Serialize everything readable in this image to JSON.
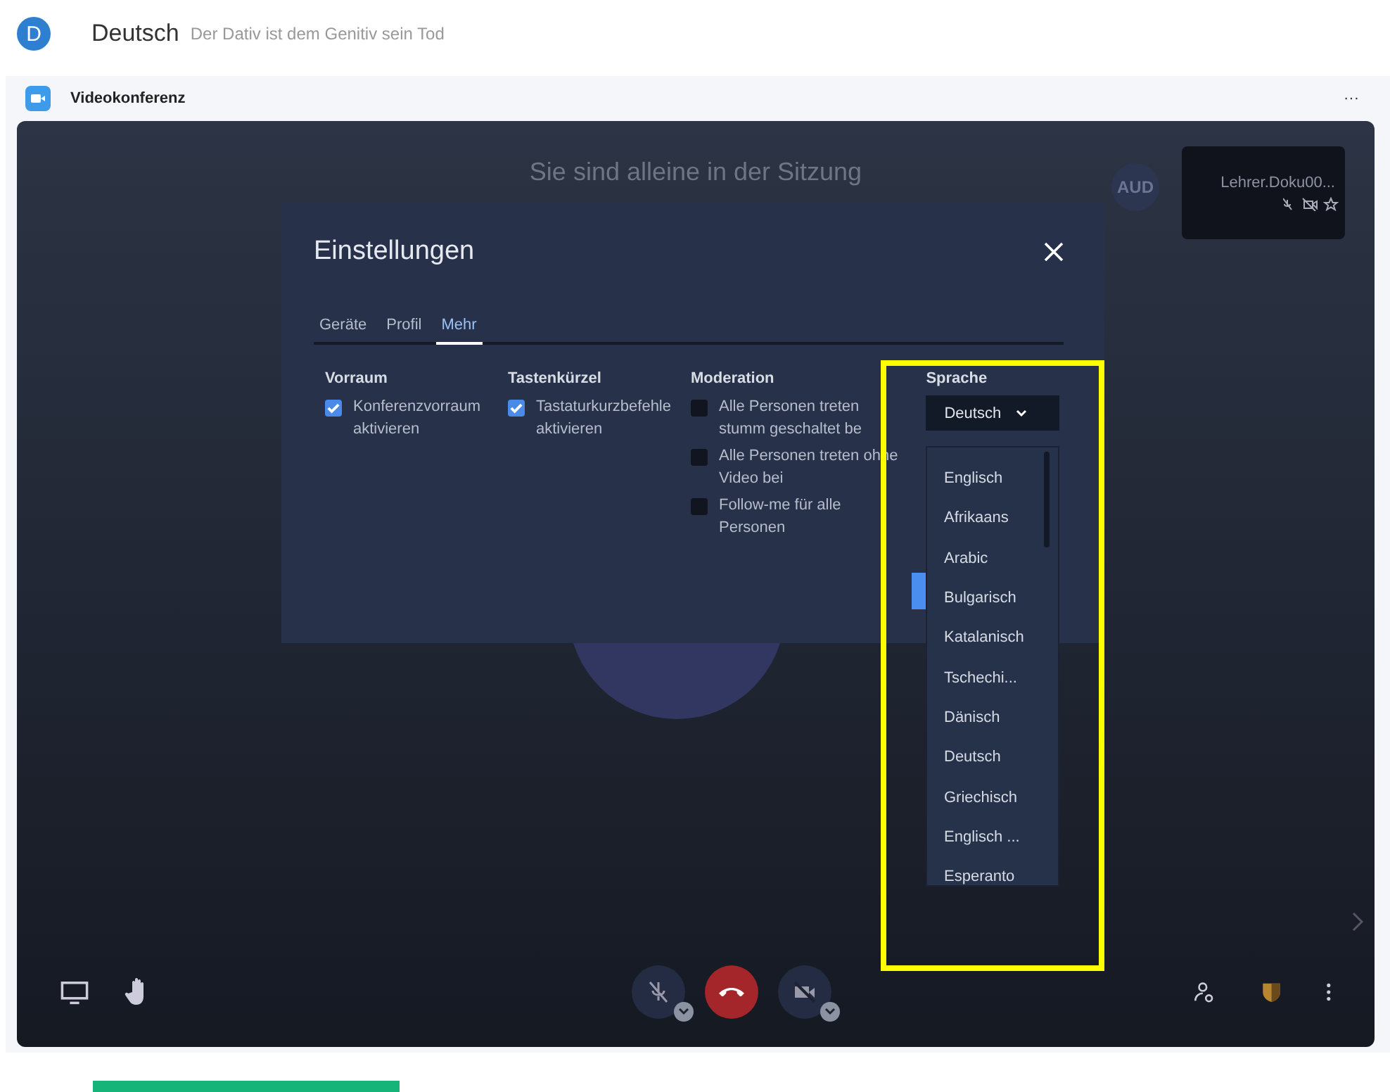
{
  "app": {
    "avatar_letter": "D",
    "title": "Deutsch",
    "subtitle": "Der Dativ ist dem Genitiv sein Tod"
  },
  "panel": {
    "title": "Videokonferenz",
    "menu": "···"
  },
  "conference": {
    "status": "Sie sind alleine in der Sitzung",
    "participant_initials": "AUD",
    "thumbnail_name": "Lehrer.Doku00..."
  },
  "settings": {
    "title": "Einstellungen",
    "tabs": [
      {
        "label": "Geräte",
        "selected": false
      },
      {
        "label": "Profil",
        "selected": false
      },
      {
        "label": "Mehr",
        "selected": true
      }
    ],
    "sections": [
      {
        "heading": "Vorraum",
        "options": [
          {
            "label": "Konferenzvorraum aktivieren",
            "checked": true
          }
        ]
      },
      {
        "heading": "Tastenkürzel",
        "options": [
          {
            "label": "Tastaturkurzbefehle aktivieren",
            "checked": true
          }
        ]
      },
      {
        "heading": "Moderation",
        "options": [
          {
            "label": "Alle Personen treten stumm geschaltet be",
            "checked": false
          },
          {
            "label": "Alle Personen treten ohne Video bei",
            "checked": false
          },
          {
            "label": "Follow-me für alle Personen",
            "checked": false
          }
        ]
      }
    ],
    "language": {
      "heading": "Sprache",
      "value": "Deutsch",
      "options": [
        "Englisch",
        "Afrikaans",
        "Arabic",
        "Bulgarisch",
        "Katalanisch",
        "Tschechi...",
        "Dänisch",
        "Deutsch",
        "Griechisch",
        "Englisch ...",
        "Esperanto"
      ]
    }
  }
}
